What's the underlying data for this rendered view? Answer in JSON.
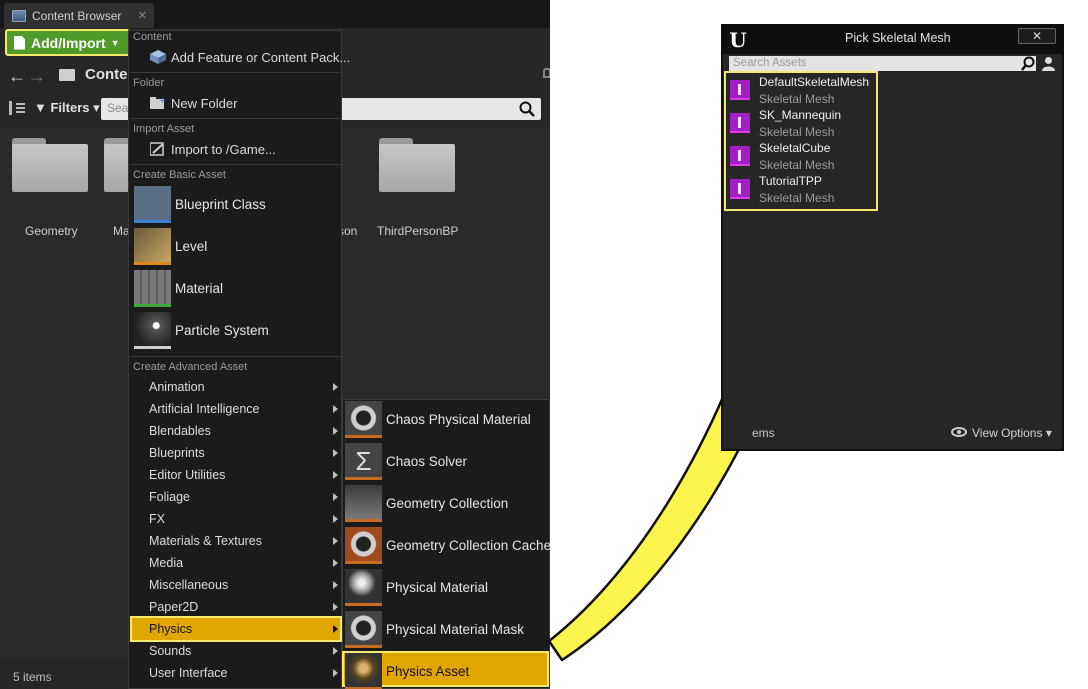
{
  "content_browser": {
    "tab_title": "Content Browser",
    "add_import_label": "Add/Import",
    "path_label": "Content",
    "filters_label": "Filters",
    "search_placeholder": "Search",
    "folders": [
      "Geometry",
      "Ma",
      "son",
      "ThirdPersonBP"
    ],
    "item_count": "5 items"
  },
  "menu": {
    "sections": {
      "content": "Content",
      "folder": "Folder",
      "import_asset": "Import Asset",
      "create_basic": "Create Basic Asset",
      "create_advanced": "Create Advanced Asset"
    },
    "add_feature": "Add Feature or Content Pack...",
    "new_folder": "New Folder",
    "import_to_game": "Import to /Game...",
    "basic_assets": [
      "Blueprint Class",
      "Level",
      "Material",
      "Particle System"
    ],
    "advanced_assets": [
      "Animation",
      "Artificial Intelligence",
      "Blendables",
      "Blueprints",
      "Editor Utilities",
      "Foliage",
      "FX",
      "Materials & Textures",
      "Media",
      "Miscellaneous",
      "Paper2D",
      "Physics",
      "Sounds",
      "User Interface"
    ]
  },
  "physics_submenu": [
    "Chaos Physical Material",
    "Chaos Solver",
    "Geometry Collection",
    "Geometry Collection Cache",
    "Physical Material",
    "Physical Material Mask",
    "Physics Asset"
  ],
  "dialog": {
    "title": "Pick Skeletal Mesh",
    "close_label": "✕",
    "search_placeholder": "Search Assets",
    "assets": [
      {
        "name": "DefaultSkeletalMesh",
        "type": "Skeletal Mesh"
      },
      {
        "name": "SK_Mannequin",
        "type": "Skeletal Mesh"
      },
      {
        "name": "SkeletalCube",
        "type": "Skeletal Mesh"
      },
      {
        "name": "TutorialTPP",
        "type": "Skeletal Mesh"
      }
    ],
    "items_label": "ems",
    "view_options": "View Options"
  },
  "colors": {
    "highlight": "#e2a600",
    "highlight_border": "#f4e96a",
    "arrow": "#fbf54d",
    "add_import_green": "#4f9a29",
    "skeletal_mesh_icon": "#a220c3"
  }
}
